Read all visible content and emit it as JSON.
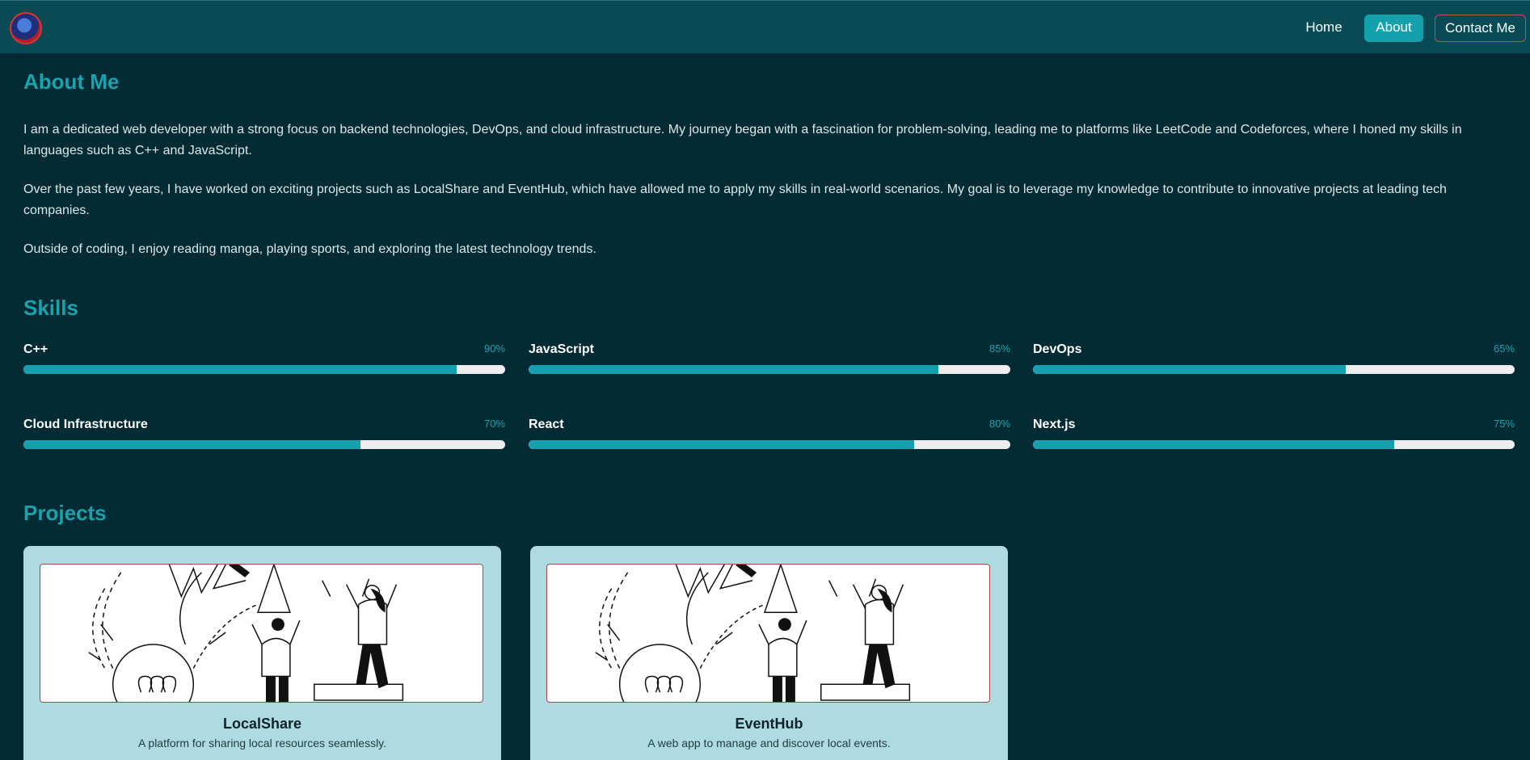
{
  "nav": {
    "logo_alt": "logo",
    "links": [
      {
        "label": "Home"
      },
      {
        "label": "About"
      },
      {
        "label": "Contact Me"
      }
    ],
    "active_color": "#14a0ad"
  },
  "about": {
    "title": "About Me",
    "paragraphs": [
      "I am a dedicated web developer with a strong focus on backend technologies, DevOps, and cloud infrastructure. My journey began with a fascination for problem-solving, leading me to platforms like LeetCode and Codeforces, where I honed my skills in languages such as C++ and JavaScript.",
      "Over the past few years, I have worked on exciting projects such as LocalShare and EventHub, which have allowed me to apply my skills in real-world scenarios. My goal is to leverage my knowledge to contribute to innovative projects at leading tech companies.",
      "Outside of coding, I enjoy reading manga, playing sports, and exploring the latest technology trends."
    ]
  },
  "skills": {
    "title": "Skills",
    "items": [
      {
        "name": "C++",
        "percent_label": "90%",
        "level": 0.9
      },
      {
        "name": "JavaScript",
        "percent_label": "85%",
        "level": 0.85
      },
      {
        "name": "DevOps",
        "percent_label": "65%",
        "level": 0.65
      },
      {
        "name": "Cloud Infrastructure",
        "percent_label": "70%",
        "level": 0.7
      },
      {
        "name": "React",
        "percent_label": "80%",
        "level": 0.8
      },
      {
        "name": "Next.js",
        "percent_label": "75%",
        "level": 0.75
      }
    ]
  },
  "projects": {
    "title": "Projects",
    "items": [
      {
        "name": "LocalShare",
        "description": "A platform for sharing local resources seamlessly.",
        "image_icon": "celebration-illustration"
      },
      {
        "name": "EventHub",
        "description": "A web app to manage and discover local events.",
        "image_icon": "celebration-illustration"
      }
    ]
  },
  "colors": {
    "background": "#032b33",
    "navbar": "#0a4a55",
    "accent": "#1aa2ad",
    "card": "#aedbe2"
  }
}
